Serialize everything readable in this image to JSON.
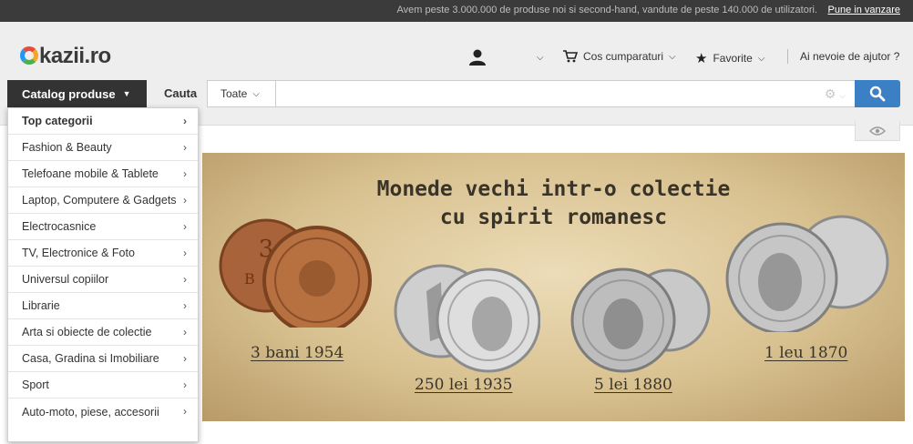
{
  "topbar": {
    "message": "Avem peste 3.000.000 de produse noi si second-hand, vandute de peste 140.000 de utilizatori.",
    "sell_link": "Pune in vanzare"
  },
  "header": {
    "logo": "kazii.ro",
    "cart_label": "Cos cumparaturi",
    "favorites_label": "Favorite",
    "help_label": "Ai nevoie de ajutor ?"
  },
  "search": {
    "catalog_label": "Catalog produse",
    "cauta_label": "Cauta",
    "category_value": "Toate",
    "placeholder": ""
  },
  "menu": {
    "items": [
      "Top categorii",
      "Fashion & Beauty",
      "Telefoane mobile & Tablete",
      "Laptop, Computere & Gadgets",
      "Electrocasnice",
      "TV, Electronice & Foto",
      "Universul copiilor",
      "Librarie",
      "Arta si obiecte de colectie",
      "Casa, Gradina si Imobiliare",
      "Sport",
      "Auto-moto, piese, accesorii"
    ]
  },
  "banner": {
    "title_line1": "Monede vechi intr-o colectie",
    "title_line2": "cu spirit romanesc",
    "coins": [
      "3 bani 1954",
      "250 lei 1935",
      "5 lei 1880",
      "1 leu 1870"
    ]
  },
  "colors": {
    "accent": "#3b7fc4",
    "dark": "#333333",
    "topbar": "#3b3b3b"
  }
}
